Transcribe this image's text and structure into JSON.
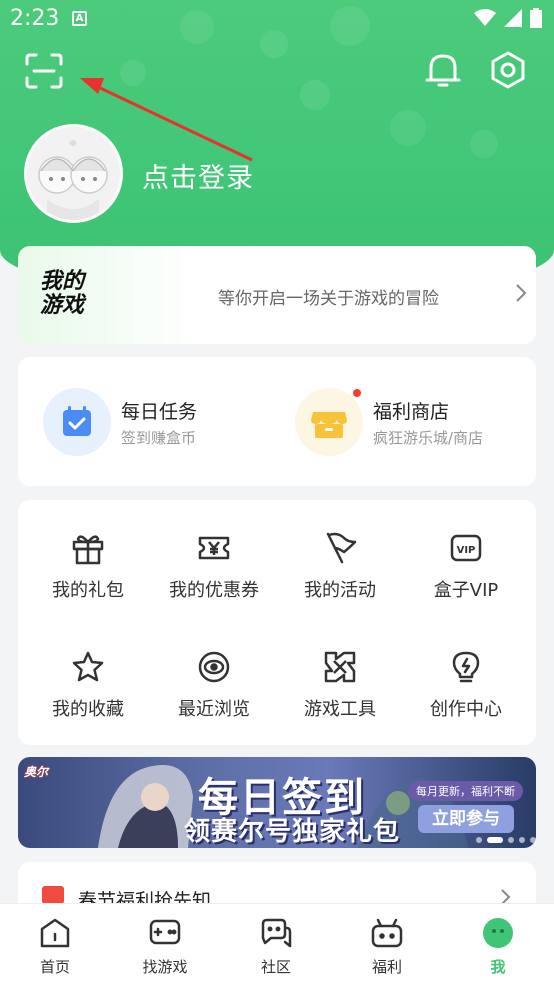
{
  "status_bar": {
    "time": "2:23",
    "notif_letter": "A"
  },
  "header": {
    "login_text": "点击登录"
  },
  "intro": {
    "logo_line1": "我的",
    "logo_line2": "游戏",
    "text": "等你开启一场关于游戏的冒险"
  },
  "tasks": [
    {
      "title": "每日任务",
      "subtitle": "签到赚盒币",
      "icon": "calendar-check-icon",
      "color": "#4a8bf5"
    },
    {
      "title": "福利商店",
      "subtitle": "疯狂游乐城/商店",
      "icon": "shop-icon",
      "color": "#f6c33a"
    }
  ],
  "grid": [
    {
      "label": "我的礼包",
      "icon": "gift-icon"
    },
    {
      "label": "我的优惠券",
      "icon": "coupon-icon"
    },
    {
      "label": "我的活动",
      "icon": "flag-icon"
    },
    {
      "label": "盒子VIP",
      "icon": "vip-icon"
    },
    {
      "label": "我的收藏",
      "icon": "star-icon"
    },
    {
      "label": "最近浏览",
      "icon": "eye-icon"
    },
    {
      "label": "游戏工具",
      "icon": "tools-icon"
    },
    {
      "label": "创作中心",
      "icon": "bulb-icon"
    }
  ],
  "banner": {
    "game_name": "奥尔",
    "title_line1": "每日签到",
    "title_line2": "领赛尔号独家礼包",
    "pill_text": "每月更新，福利不断",
    "button_text": "立即参与"
  },
  "news": {
    "text": "春节福利抢先知"
  },
  "tabs": [
    {
      "label": "首页",
      "icon": "home-icon"
    },
    {
      "label": "找游戏",
      "icon": "gamepad-icon"
    },
    {
      "label": "社区",
      "icon": "chat-icon"
    },
    {
      "label": "福利",
      "icon": "gift-box-icon"
    },
    {
      "label": "我",
      "icon": "face-icon",
      "active": true
    }
  ],
  "colors": {
    "accent": "#3fc576",
    "red_badge": "#ff3b30"
  }
}
